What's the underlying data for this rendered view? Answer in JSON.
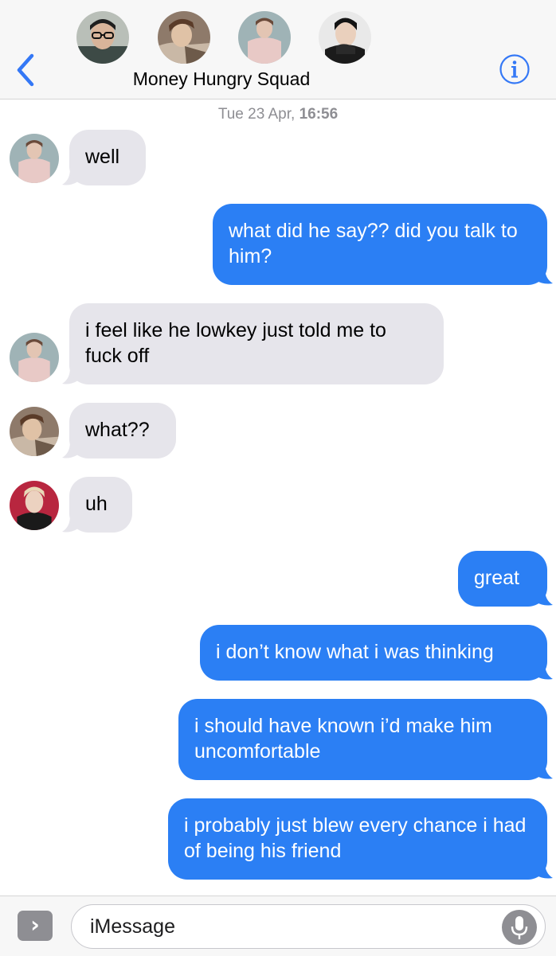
{
  "header": {
    "group_name": "Money Hungry Squad",
    "avatars": [
      "person-avatar-1",
      "person-avatar-2",
      "person-avatar-3",
      "person-avatar-4"
    ]
  },
  "timestamp": {
    "day": "Tue 23 Apr,",
    "time": "16:56"
  },
  "messages": [
    {
      "direction": "incoming",
      "text": "well"
    },
    {
      "direction": "outgoing",
      "text": "what did he say?? did you talk to him?"
    },
    {
      "direction": "incoming",
      "text": "i feel like he lowkey just told me to fuck off"
    },
    {
      "direction": "incoming",
      "text": "what??"
    },
    {
      "direction": "incoming",
      "text": "uh"
    },
    {
      "direction": "outgoing",
      "text": "great"
    },
    {
      "direction": "outgoing",
      "text": "i don’t know what i was thinking"
    },
    {
      "direction": "outgoing",
      "text": "i should have known i’d make him uncomfortable"
    },
    {
      "direction": "outgoing",
      "text": "i probably just blew every chance i had of being his friend"
    }
  ],
  "input": {
    "placeholder": "iMessage",
    "apps_glyph": "›"
  },
  "colors": {
    "accent": "#2b7ff4",
    "incoming_bubble": "#e6e5eb",
    "outgoing_bubble": "#2b7ff4",
    "icon_blue": "#3478f6"
  },
  "icons": [
    "back-chevron-icon",
    "info-icon",
    "apps-icon",
    "microphone-icon"
  ]
}
